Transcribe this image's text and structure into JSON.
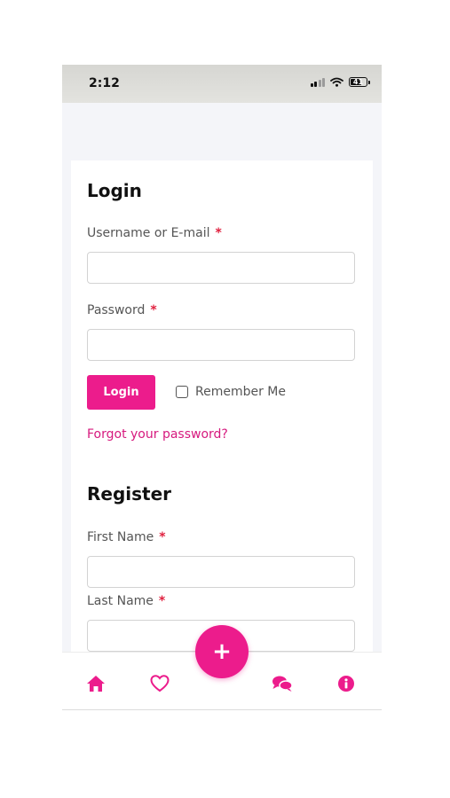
{
  "status_bar": {
    "time": "2:12",
    "battery": "41"
  },
  "login": {
    "heading": "Login",
    "username_label": "Username or E-mail",
    "password_label": "Password",
    "required_mark": "*",
    "login_button": "Login",
    "remember_label": "Remember Me",
    "forgot_link": "Forgot your password?"
  },
  "register": {
    "heading": "Register",
    "first_name_label": "First Name",
    "last_name_label": "Last Name",
    "required_mark": "*"
  },
  "bottom_nav": {
    "items": [
      "home-icon",
      "heart-icon",
      "chat-icon",
      "info-icon"
    ],
    "fab_label": "+"
  },
  "colors": {
    "accent": "#ec1c8c",
    "required": "#e0213f",
    "link": "#d6197e"
  }
}
